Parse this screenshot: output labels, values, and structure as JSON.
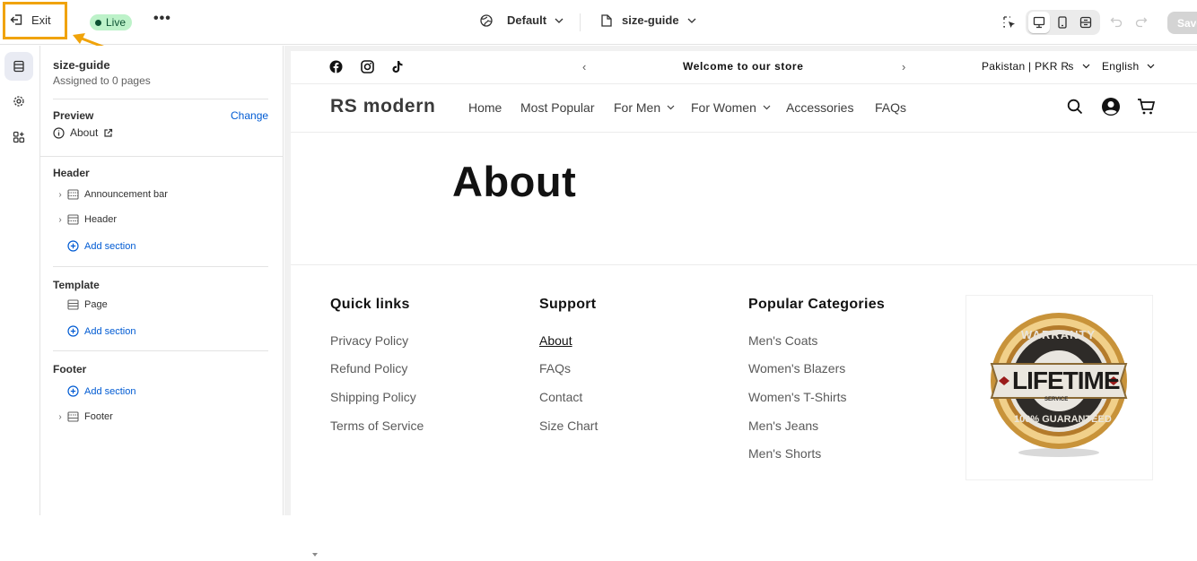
{
  "topbar": {
    "exit_label": "Exit",
    "live_label": "Live",
    "more_label": "•••",
    "theme_label": "Default",
    "template_label": "size-guide",
    "save_label": "Save"
  },
  "sidebar": {
    "template_name": "size-guide",
    "assigned": "Assigned to 0 pages",
    "preview_heading": "Preview",
    "preview_change": "Change",
    "preview_page": "About",
    "groups": {
      "header": {
        "title": "Header",
        "items": [
          "Announcement bar",
          "Header"
        ],
        "add": "Add section"
      },
      "template": {
        "title": "Template",
        "items": [
          "Page"
        ],
        "add": "Add section"
      },
      "footer": {
        "title": "Footer",
        "add": "Add section",
        "items": [
          "Footer"
        ]
      }
    }
  },
  "store": {
    "announcement": "Welcome to our store",
    "country": "Pakistan | PKR ₨",
    "language": "English",
    "brand": "RS modern",
    "nav": [
      "Home",
      "Most Popular",
      "For Men",
      "For Women",
      "Accessories",
      "FAQs"
    ],
    "page_title": "About",
    "footer": {
      "quick_links": {
        "title": "Quick links",
        "items": [
          "Privacy Policy",
          "Refund Policy",
          "Shipping Policy",
          "Terms of Service"
        ]
      },
      "support": {
        "title": "Support",
        "items": [
          "About",
          "FAQs",
          "Contact",
          "Size Chart"
        ]
      },
      "categories": {
        "title": "Popular Categories",
        "items": [
          "Men's Coats",
          "Women's Blazers",
          "Women's T-Shirts",
          "Men's Jeans",
          "Men's Shorts"
        ]
      }
    },
    "badge": {
      "top": "WARRANTY",
      "main": "LIFETIME",
      "small": "SERVICE",
      "bottom": "100% GUARANTEED"
    }
  },
  "colors": {
    "accent": "#005bd3",
    "highlight": "#f0a30a",
    "live_bg": "#bdf2c9"
  }
}
